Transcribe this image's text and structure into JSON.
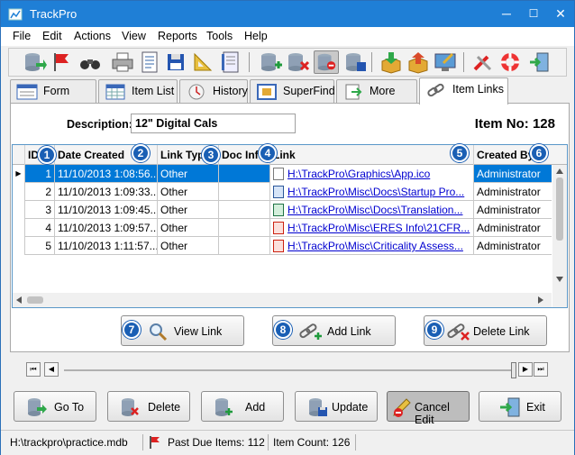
{
  "window": {
    "title": "TrackPro",
    "minimize": "─",
    "maximize": "☐",
    "close": "✕"
  },
  "menu": [
    "File",
    "Edit",
    "Actions",
    "View",
    "Reports",
    "Tools",
    "Help"
  ],
  "tabs": [
    {
      "label": "Form View",
      "icon": "form-view-icon"
    },
    {
      "label": "Item List",
      "icon": "calendar-grid-icon"
    },
    {
      "label": "History",
      "icon": "clock-icon"
    },
    {
      "label": "SuperFind",
      "icon": "superfind-icon"
    },
    {
      "label": "More Info",
      "icon": "page-arrow-icon"
    },
    {
      "label": "Item Links",
      "icon": "chain-link-icon"
    }
  ],
  "active_tab": "Item Links",
  "detail": {
    "description_label": "Description:",
    "description_value": "12\" Digital Cals",
    "item_no_label": "Item No: 128"
  },
  "grid": {
    "columns": [
      "ID",
      "Date Created",
      "Link Type",
      "Doc Info",
      "Link",
      "Created By"
    ],
    "badges": [
      "1",
      "2",
      "3",
      "4",
      "5",
      "6"
    ],
    "rows": [
      {
        "id": "1",
        "date": "11/10/2013 1:08:56...",
        "type": "Other",
        "doc": "",
        "link": "H:\\TrackPro\\Graphics\\App.ico",
        "by": "Administrator",
        "file_icon": "image-file-icon"
      },
      {
        "id": "2",
        "date": "11/10/2013 1:09:33...",
        "type": "Other",
        "doc": "",
        "link": "H:\\TrackPro\\Misc\\Docs\\Startup Pro...",
        "by": "Administrator",
        "file_icon": "word-file-icon"
      },
      {
        "id": "3",
        "date": "11/10/2013 1:09:45...",
        "type": "Other",
        "doc": "",
        "link": "H:\\TrackPro\\Misc\\Docs\\Translation...",
        "by": "Administrator",
        "file_icon": "excel-file-icon"
      },
      {
        "id": "4",
        "date": "11/10/2013 1:09:57...",
        "type": "Other",
        "doc": "",
        "link": "H:\\TrackPro\\Misc\\ERES Info\\21CFR...",
        "by": "Administrator",
        "file_icon": "pdf-file-icon"
      },
      {
        "id": "5",
        "date": "11/10/2013 1:11:57...",
        "type": "Other",
        "doc": "",
        "link": "H:\\TrackPro\\Misc\\Criticality Assess...",
        "by": "Administrator",
        "file_icon": "pdf-file-icon"
      }
    ],
    "row_marker": "▶"
  },
  "link_actions": [
    {
      "badge": "7",
      "label": "View Link",
      "icon": "magnifier-icon"
    },
    {
      "badge": "8",
      "label": "Add Link",
      "icon": "chain-add-icon"
    },
    {
      "badge": "9",
      "label": "Delete Link",
      "icon": "chain-delete-icon"
    }
  ],
  "navigator": {
    "first": "⏮",
    "prev": "◀",
    "next": "▶",
    "last": "⏭"
  },
  "bottom_buttons": [
    {
      "label": "Go To",
      "icon": "database-arrow-icon"
    },
    {
      "label": "Delete",
      "icon": "database-delete-icon"
    },
    {
      "label": "Add",
      "icon": "database-add-icon"
    },
    {
      "label": "Update",
      "icon": "database-save-icon"
    },
    {
      "label": "Cancel Edit",
      "icon": "pencil-cancel-icon"
    },
    {
      "label": "Exit",
      "icon": "exit-door-icon"
    }
  ],
  "status": {
    "db_path": "H:\\trackpro\\practice.mdb",
    "past_due": "Past Due Items: 112",
    "item_count": "Item Count: 126"
  },
  "colors": {
    "titlebar": "#1f7fd6",
    "selection": "#0078d7",
    "badge": "#1a5fb4",
    "link": "#0000d0"
  }
}
